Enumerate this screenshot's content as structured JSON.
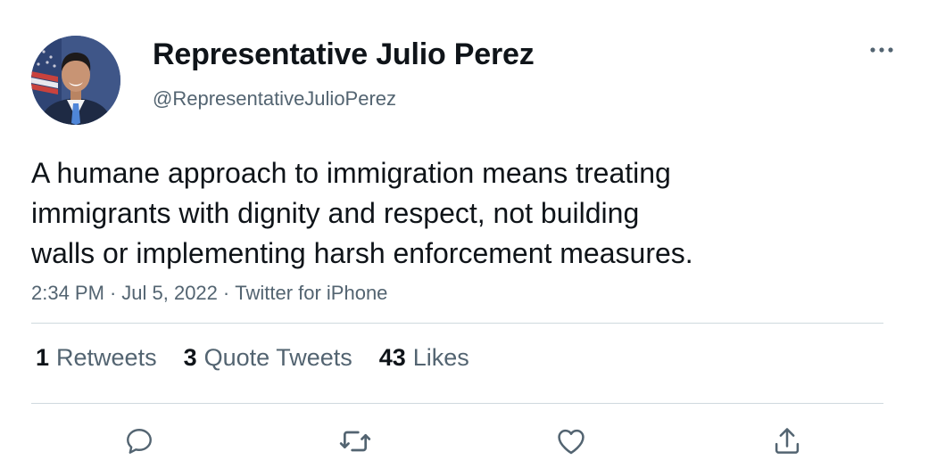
{
  "author": {
    "display_name": "Representative Julio Perez",
    "handle": "@RepresentativeJulioPerez",
    "avatar_icon": "profile-photo"
  },
  "tweet": {
    "text": "A humane approach to immigration means treating\nimmigrants with dignity and respect, not building\nwalls or implementing harsh enforcement measures.",
    "time": "2:34 PM",
    "separator": "·",
    "date": "Jul 5, 2022",
    "source": "Twitter for iPhone"
  },
  "stats": {
    "retweets_count": "1",
    "retweets_label": "Retweets",
    "quotes_count": "3",
    "quotes_label": "Quote Tweets",
    "likes_count": "43",
    "likes_label": "Likes"
  },
  "actions": [
    {
      "icon": "reply-icon"
    },
    {
      "icon": "retweet-icon"
    },
    {
      "icon": "like-icon"
    },
    {
      "icon": "share-icon"
    }
  ],
  "colors": {
    "text_primary": "#0f1419",
    "text_secondary": "#536471",
    "divider": "#cfd9de",
    "icon": "#536471"
  }
}
